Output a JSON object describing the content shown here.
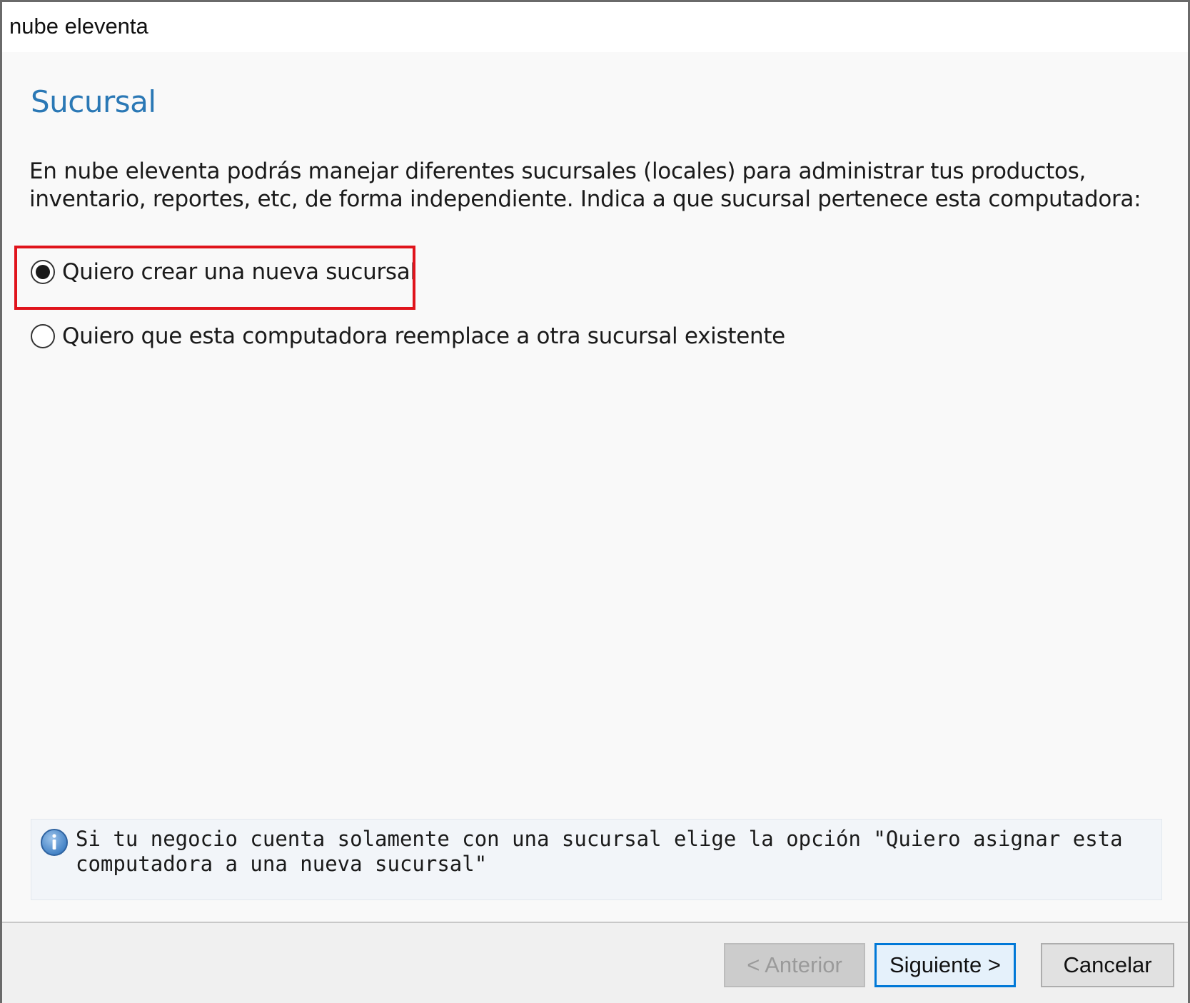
{
  "window": {
    "title": "nube eleventa"
  },
  "page": {
    "title": "Sucursal",
    "intro": "En nube eleventa podrás manejar diferentes sucursales (locales) para administrar tus productos, inventario, reportes, etc, de forma independiente. Indica a que sucursal pertenece esta computadora:"
  },
  "options": [
    {
      "label": "Quiero crear una nueva sucursal",
      "selected": true
    },
    {
      "label": "Quiero que esta computadora reemplace a otra sucursal existente",
      "selected": false
    }
  ],
  "info": {
    "icon": "info-icon",
    "text": "Si tu negocio cuenta solamente con una sucursal elige la opción \"Quiero asignar esta computadora a una nueva sucursal\""
  },
  "buttons": {
    "prev_label": "< Anterior",
    "next_label": "Siguiente >",
    "cancel_label": "Cancelar"
  },
  "colors": {
    "title_blue": "#2a78b5",
    "highlight_red": "#e0141c",
    "focus_blue": "#0078d7"
  }
}
